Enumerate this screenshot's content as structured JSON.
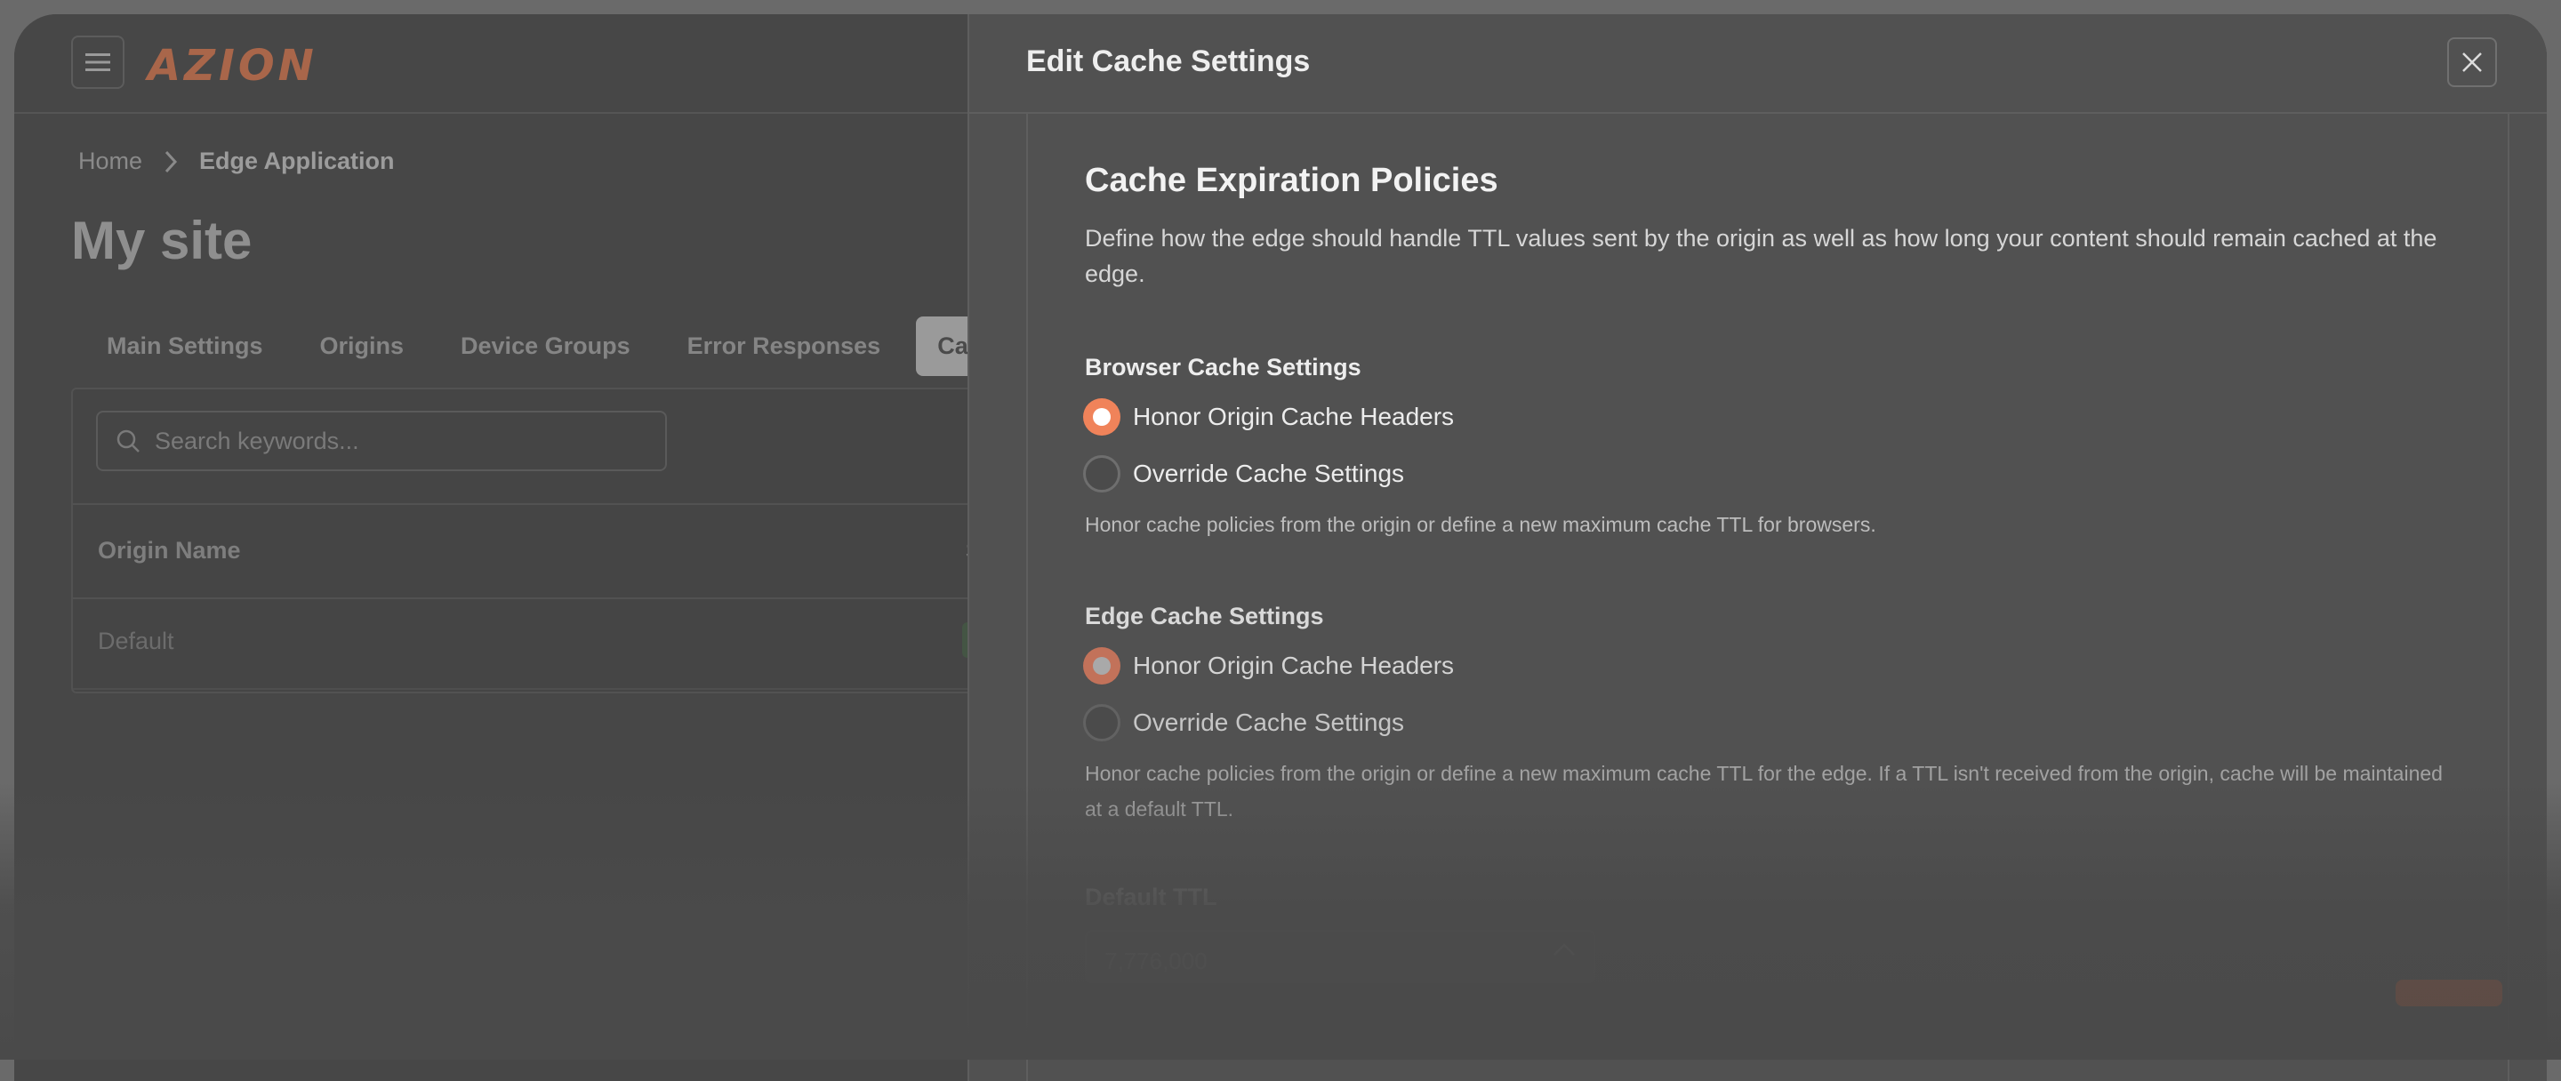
{
  "app": {
    "logo": "AZION"
  },
  "breadcrumb": {
    "home": "Home",
    "current": "Edge Application"
  },
  "page": {
    "title": "My site"
  },
  "tabs": [
    "Main Settings",
    "Origins",
    "Device Groups",
    "Error Responses",
    "Cache"
  ],
  "search": {
    "placeholder": "Search keywords..."
  },
  "table": {
    "columns": [
      "Origin Name",
      "St"
    ],
    "rows": [
      {
        "name": "Default"
      }
    ]
  },
  "drawer": {
    "title": "Edit Cache Settings",
    "section_title": "Cache Expiration Policies",
    "section_desc": "Define how the edge should handle TTL values sent by the origin as well as how long your content should remain cached at the edge.",
    "browser": {
      "label": "Browser Cache Settings",
      "options": [
        "Honor Origin Cache Headers",
        "Override Cache Settings"
      ],
      "selected": 0,
      "help": "Honor cache policies from the origin or define a new maximum cache TTL for browsers."
    },
    "edge": {
      "label": "Edge Cache Settings",
      "options": [
        "Honor Origin Cache Headers",
        "Override Cache Settings"
      ],
      "selected": 0,
      "help": "Honor cache policies from the origin or define a new maximum cache TTL for the edge. If a TTL isn't received from the origin, cache will be maintained at a default TTL."
    },
    "default_ttl": {
      "label": "Default TTL",
      "value": "7,776,000"
    }
  },
  "colors": {
    "accent": "#f0835a",
    "logo": "#a9664a"
  }
}
